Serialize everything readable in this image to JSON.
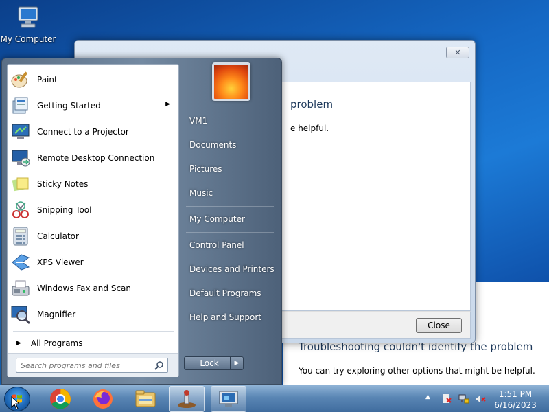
{
  "desktop": {
    "icon_label": "My Computer"
  },
  "window_back": {
    "title": "Troubleshooting couldn't identify the problem",
    "text": "You can try exploring other options that might be helpful."
  },
  "window_front": {
    "title_fragment": "problem",
    "text_fragment": "e helpful.",
    "close_button": "Close"
  },
  "start_menu": {
    "programs": [
      {
        "label": "Paint",
        "icon": "paint-icon"
      },
      {
        "label": "Getting Started",
        "icon": "getting-started-icon",
        "has_submenu": true
      },
      {
        "label": "Connect to a Projector",
        "icon": "projector-icon"
      },
      {
        "label": "Remote Desktop Connection",
        "icon": "remote-desktop-icon"
      },
      {
        "label": "Sticky Notes",
        "icon": "sticky-notes-icon"
      },
      {
        "label": "Snipping Tool",
        "icon": "snipping-tool-icon"
      },
      {
        "label": "Calculator",
        "icon": "calculator-icon"
      },
      {
        "label": "XPS Viewer",
        "icon": "xps-viewer-icon"
      },
      {
        "label": "Windows Fax and Scan",
        "icon": "fax-scan-icon"
      },
      {
        "label": "Magnifier",
        "icon": "magnifier-icon"
      }
    ],
    "all_programs": "All Programs",
    "search_placeholder": "Search programs and files",
    "right_items": [
      {
        "label": "VM1"
      },
      {
        "label": "Documents"
      },
      {
        "label": "Pictures"
      },
      {
        "label": "Music"
      },
      {
        "label": "My Computer"
      },
      {
        "label": "Control Panel"
      },
      {
        "label": "Devices and Printers"
      },
      {
        "label": "Default Programs"
      },
      {
        "label": "Help and Support"
      }
    ],
    "lock_label": "Lock"
  },
  "taskbar": {
    "apps": [
      "chrome-icon",
      "firefox-icon",
      "file-explorer-icon",
      "troubleshooter-icon",
      "remote-session-icon"
    ],
    "time": "1:51 PM",
    "date": "6/16/2023"
  }
}
